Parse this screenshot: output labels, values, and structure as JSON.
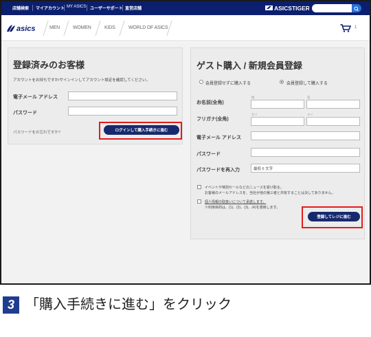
{
  "topbar": {
    "links": [
      "店舗検索",
      "マイアカウント",
      "MY ASICS",
      "ユーザーサポート",
      "直営店舗"
    ],
    "brand_logo_text": "ASICSTIGER",
    "search_icon": "search-icon"
  },
  "nav": {
    "logo_text": "asics",
    "items": [
      "MEN",
      "WOMEN",
      "KIDS",
      "WORLD OF ASICS"
    ],
    "cart_icon": "cart-icon",
    "cart_count": "1"
  },
  "login": {
    "title": "登録済みのお客様",
    "description": "アカウントをお持ちですか/サインインしてアカウント設定を確認してください。",
    "email_label": "電子メール アドレス",
    "email_value": "",
    "password_label": "パスワード",
    "password_value": "",
    "forgot_link": "パスワードをお忘れですか?",
    "submit_label": "ログインして購入手続きに進む"
  },
  "guest": {
    "title": "ゲスト購入 / 新規会員登録",
    "radio_guest_label": "会員登録せずに購入する",
    "radio_register_label": "会員登録して購入する",
    "radio_selected": "register",
    "name_label": "お名前(全角)",
    "lastname_hint": "姓",
    "firstname_hint": "名",
    "kana_label": "フリガナ(全角)",
    "lastname_kana_hint": "セイ",
    "firstname_kana_hint": "メイ",
    "email_label": "電子メール アドレス",
    "password_label": "パスワード",
    "password_confirm_label": "パスワードを再入力",
    "password_confirm_placeholder": "最低 6 文字",
    "newsletter_label": "イベントや特別セールなどのニュースを受け取る。",
    "newsletter_sub": "お客様のメールアドレスを、当社が他の第三者と共有することは決してありません。",
    "privacy_label": "個人情報の取扱いについて承諾します。",
    "privacy_sub": "※利用目的は、(1)、(2)、(3)、(4)を適用します。",
    "submit_label": "登録してレジに進む"
  },
  "caption": {
    "step": "3",
    "text": "「購入手続きに進む」をクリック"
  },
  "colors": {
    "topbar": "#0c1f6e",
    "button": "#17296e",
    "highlight": "#e31b1b",
    "step_badge": "#1f3d8f"
  }
}
